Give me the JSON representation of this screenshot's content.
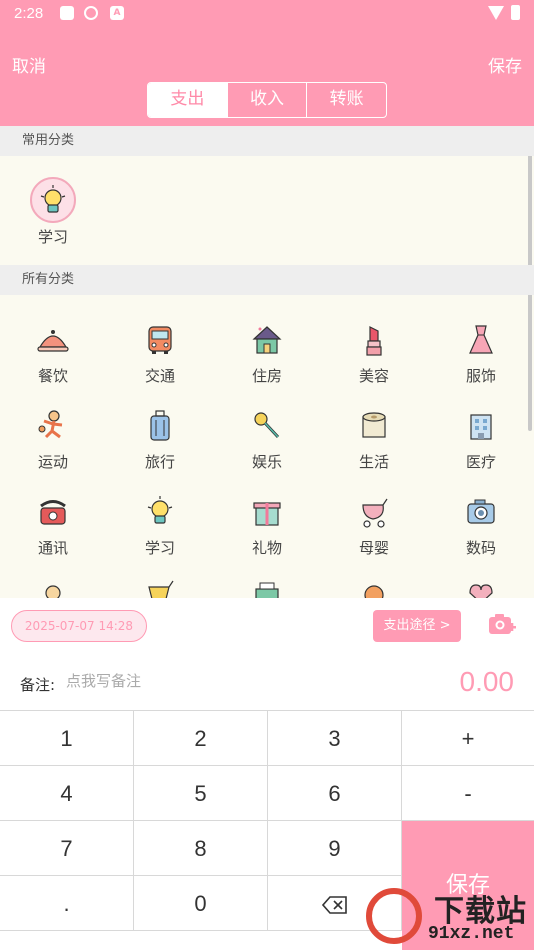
{
  "status_bar": {
    "time": "2:28",
    "notif_icon_a": "A"
  },
  "header": {
    "cancel_label": "取消",
    "save_label": "保存",
    "tabs": [
      {
        "label": "支出",
        "active": true
      },
      {
        "label": "收入",
        "active": false
      },
      {
        "label": "转账",
        "active": false
      }
    ]
  },
  "frequent": {
    "section_title": "常用分类",
    "items": [
      {
        "label": "学习",
        "icon": "lightbulb-icon"
      }
    ]
  },
  "all": {
    "section_title": "所有分类",
    "items": [
      {
        "label": "餐饮",
        "icon": "food-cover-icon"
      },
      {
        "label": "交通",
        "icon": "bus-icon"
      },
      {
        "label": "住房",
        "icon": "house-icon"
      },
      {
        "label": "美容",
        "icon": "lipstick-icon"
      },
      {
        "label": "服饰",
        "icon": "dress-icon"
      },
      {
        "label": "运动",
        "icon": "sport-kid-icon"
      },
      {
        "label": "旅行",
        "icon": "suitcase-icon"
      },
      {
        "label": "娱乐",
        "icon": "microphone-icon"
      },
      {
        "label": "生活",
        "icon": "toilet-paper-icon"
      },
      {
        "label": "医疗",
        "icon": "hospital-icon"
      },
      {
        "label": "通讯",
        "icon": "telephone-icon"
      },
      {
        "label": "学习",
        "icon": "lightbulb-icon"
      },
      {
        "label": "礼物",
        "icon": "gift-icon"
      },
      {
        "label": "母婴",
        "icon": "stroller-icon"
      },
      {
        "label": "数码",
        "icon": "camera-icon"
      }
    ]
  },
  "entry": {
    "datetime": "2025-07-07 14:28",
    "route_button": "支出途径 >",
    "note_label": "备注:",
    "note_placeholder": "点我写备注",
    "amount": "0.00"
  },
  "keypad": {
    "keys": [
      "1",
      "2",
      "3",
      "+",
      "4",
      "5",
      "6",
      "-",
      "7",
      "8",
      "9",
      ".",
      "0"
    ],
    "save_label": "保存"
  },
  "watermark": {
    "text": "下载站",
    "url": "91xz.net"
  },
  "colors": {
    "accent": "#ff9bb4",
    "background": "#fbfaf0"
  }
}
